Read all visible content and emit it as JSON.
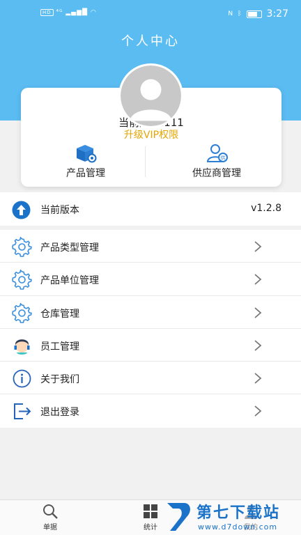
{
  "status_bar": {
    "left_text": "HD 4G",
    "time": "3:27",
    "battery_level": 0.75
  },
  "header": {
    "title": "个人中心"
  },
  "profile": {
    "current_user": "当前用户:111",
    "vip_link": "升级VIP权限",
    "actions": [
      {
        "label": "产品管理",
        "icon": "product-box-icon"
      },
      {
        "label": "供应商管理",
        "icon": "supplier-person-icon"
      }
    ]
  },
  "version": {
    "label": "当前版本",
    "value": "v1.2.8",
    "icon": "upload-arrow-icon"
  },
  "menu": [
    {
      "label": "产品类型管理",
      "icon": "gear-icon"
    },
    {
      "label": "产品单位管理",
      "icon": "gear-icon"
    },
    {
      "label": "仓库管理",
      "icon": "gear-icon"
    },
    {
      "label": "员工管理",
      "icon": "customer-service-icon"
    },
    {
      "label": "关于我们",
      "icon": "info-icon"
    },
    {
      "label": "退出登录",
      "icon": "logout-icon"
    }
  ],
  "bottom_nav": [
    {
      "label": "单据",
      "icon": "search-icon"
    },
    {
      "label": "统计",
      "icon": "grid-icon"
    },
    {
      "label": "我的",
      "icon": "user-icon"
    }
  ],
  "watermark": {
    "name": "第七下载站",
    "url": "www.d7down.com"
  },
  "colors": {
    "header_blue": "#5bbcf2",
    "vip_gold": "#e6a400",
    "accent_blue": "#1a73c9"
  }
}
